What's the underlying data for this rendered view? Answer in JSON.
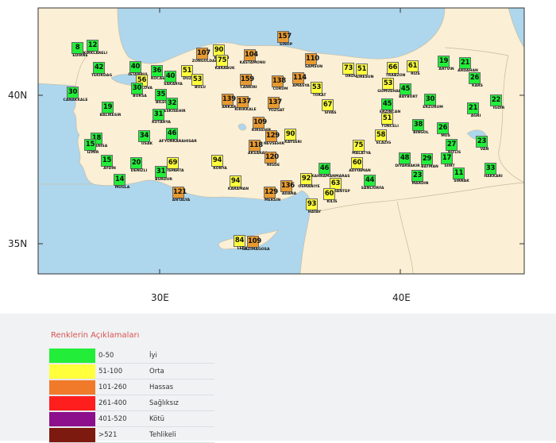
{
  "map": {
    "lat_labels": [
      "40N",
      "35N"
    ],
    "lon_labels": [
      "30E",
      "40E"
    ]
  },
  "stations": [
    {
      "city": "EDIRNE",
      "value": 8,
      "level": "iyi"
    },
    {
      "city": "KIRKLARELI",
      "value": 12,
      "level": "iyi"
    },
    {
      "city": "TEKIRDAG",
      "value": 42,
      "level": "iyi"
    },
    {
      "city": "ISTANBUL",
      "value": 40,
      "level": "iyi"
    },
    {
      "city": "KOCAELI",
      "value": 36,
      "level": "iyi"
    },
    {
      "city": "SAKARYA",
      "value": 40,
      "level": "iyi"
    },
    {
      "city": "YALOVA",
      "value": 56,
      "level": "orta"
    },
    {
      "city": "DUZCE",
      "value": 51,
      "level": "orta"
    },
    {
      "city": "BOLU",
      "value": 53,
      "level": "orta"
    },
    {
      "city": "ZONGULDAK",
      "value": 107,
      "level": "hassas"
    },
    {
      "city": "BARTIN",
      "value": 90,
      "level": "orta"
    },
    {
      "city": "KARABUK",
      "value": 75,
      "level": "orta"
    },
    {
      "city": "KASTAMONU",
      "value": 104,
      "level": "hassas"
    },
    {
      "city": "SINOP",
      "value": 157,
      "level": "hassas"
    },
    {
      "city": "SAMSUN",
      "value": 110,
      "level": "hassas"
    },
    {
      "city": "ORDU",
      "value": 73,
      "level": "orta"
    },
    {
      "city": "GIRESUN",
      "value": 51,
      "level": "orta"
    },
    {
      "city": "TRABZON",
      "value": 66,
      "level": "orta"
    },
    {
      "city": "RIZE",
      "value": 61,
      "level": "orta"
    },
    {
      "city": "ARTVIN",
      "value": 19,
      "level": "iyi"
    },
    {
      "city": "ARDAHAN",
      "value": 21,
      "level": "iyi"
    },
    {
      "city": "KARS",
      "value": 26,
      "level": "iyi"
    },
    {
      "city": "CANAKKALE",
      "value": 30,
      "level": "iyi"
    },
    {
      "city": "BURSA",
      "value": 30,
      "level": "iyi"
    },
    {
      "city": "BILECIK",
      "value": 35,
      "level": "iyi"
    },
    {
      "city": "ESKISEHIR",
      "value": 32,
      "level": "iyi"
    },
    {
      "city": "KUTAHYA",
      "value": 31,
      "level": "iyi"
    },
    {
      "city": "BALIKESIR",
      "value": 19,
      "level": "iyi"
    },
    {
      "city": "ANKARA",
      "value": 139,
      "level": "hassas"
    },
    {
      "city": "CANKIRI",
      "value": 159,
      "level": "hassas"
    },
    {
      "city": "KIRIKKALE",
      "value": 137,
      "level": "hassas"
    },
    {
      "city": "CORUM",
      "value": 138,
      "level": "hassas"
    },
    {
      "city": "AMASYA",
      "value": 114,
      "level": "hassas"
    },
    {
      "city": "TOKAT",
      "value": 53,
      "level": "orta"
    },
    {
      "city": "YOZGAT",
      "value": 137,
      "level": "hassas"
    },
    {
      "city": "SIVAS",
      "value": 67,
      "level": "orta"
    },
    {
      "city": "GUMUSHANE",
      "value": 53,
      "level": "orta"
    },
    {
      "city": "BAYBURT",
      "value": 45,
      "level": "iyi"
    },
    {
      "city": "ERZINCAN",
      "value": 45,
      "level": "iyi"
    },
    {
      "city": "ERZURUM",
      "value": 30,
      "level": "iyi"
    },
    {
      "city": "AGRI",
      "value": 21,
      "level": "iyi"
    },
    {
      "city": "IGDIR",
      "value": 22,
      "level": "iyi"
    },
    {
      "city": "TUNCELI",
      "value": 51,
      "level": "orta"
    },
    {
      "city": "BINGOL",
      "value": 38,
      "level": "iyi"
    },
    {
      "city": "MUS",
      "value": 26,
      "level": "iyi"
    },
    {
      "city": "BITLIS",
      "value": 27,
      "level": "iyi"
    },
    {
      "city": "VAN",
      "value": 23,
      "level": "iyi"
    },
    {
      "city": "HAKKARI",
      "value": 33,
      "level": "iyi"
    },
    {
      "city": "MANISA",
      "value": 18,
      "level": "iyi"
    },
    {
      "city": "IZMIR",
      "value": 15,
      "level": "iyi"
    },
    {
      "city": "AYDIN",
      "value": 15,
      "level": "iyi"
    },
    {
      "city": "MUGLA",
      "value": 14,
      "level": "iyi"
    },
    {
      "city": "USAK",
      "value": 34,
      "level": "iyi"
    },
    {
      "city": "AFYONKARAHISAR",
      "value": 46,
      "level": "iyi"
    },
    {
      "city": "DENIZLI",
      "value": 20,
      "level": "iyi"
    },
    {
      "city": "ISPARTA",
      "value": 69,
      "level": "orta"
    },
    {
      "city": "BURDUR",
      "value": 31,
      "level": "iyi"
    },
    {
      "city": "ANTALYA",
      "value": 121,
      "level": "hassas"
    },
    {
      "city": "KONYA",
      "value": 94,
      "level": "orta"
    },
    {
      "city": "KARAMAN",
      "value": 94,
      "level": "orta"
    },
    {
      "city": "KIRSEHIR",
      "value": 109,
      "level": "hassas"
    },
    {
      "city": "NEVSEHIR",
      "value": 129,
      "level": "hassas"
    },
    {
      "city": "AKSARAY",
      "value": 118,
      "level": "hassas"
    },
    {
      "city": "KAYSERI",
      "value": 90,
      "level": "orta"
    },
    {
      "city": "NIGDE",
      "value": 120,
      "level": "hassas"
    },
    {
      "city": "MERSIN",
      "value": 129,
      "level": "hassas"
    },
    {
      "city": "ADANA",
      "value": 136,
      "level": "hassas"
    },
    {
      "city": "OSMANIYE",
      "value": 92,
      "level": "orta"
    },
    {
      "city": "KAHRAMANMARAS",
      "value": 46,
      "level": "iyi"
    },
    {
      "city": "GAZIANTEP",
      "value": 63,
      "level": "orta"
    },
    {
      "city": "KILIS",
      "value": 60,
      "level": "orta"
    },
    {
      "city": "HATAY",
      "value": 93,
      "level": "orta"
    },
    {
      "city": "MALATYA",
      "value": 75,
      "level": "orta"
    },
    {
      "city": "ELAZIG",
      "value": 58,
      "level": "orta"
    },
    {
      "city": "ADIYAMAN",
      "value": 60,
      "level": "orta"
    },
    {
      "city": "SANLIURFA",
      "value": 44,
      "level": "iyi"
    },
    {
      "city": "DIYARBAKIR",
      "value": 48,
      "level": "iyi"
    },
    {
      "city": "BATMAN",
      "value": 29,
      "level": "iyi"
    },
    {
      "city": "SIIRT",
      "value": 17,
      "level": "iyi"
    },
    {
      "city": "MARDIN",
      "value": 23,
      "level": "iyi"
    },
    {
      "city": "SIRNAK",
      "value": 11,
      "level": "iyi"
    },
    {
      "city": "LEFK",
      "value": 84,
      "level": "orta"
    },
    {
      "city": "GAZIMAGOSA",
      "value": 109,
      "level": "hassas"
    }
  ],
  "legend": {
    "title": "Renklerin Açıklamaları",
    "items": [
      {
        "range": "0-50",
        "label": "İyi",
        "color": "#22ee3a"
      },
      {
        "range": "51-100",
        "label": "Orta",
        "color": "#ffff3c"
      },
      {
        "range": "101-260",
        "label": "Hassas",
        "color": "#f07a2a"
      },
      {
        "range": "261-400",
        "label": "Sağlıksız",
        "color": "#ff1e1e"
      },
      {
        "range": "401-520",
        "label": "Kötü",
        "color": "#8c0f8c"
      },
      {
        "range": ">521",
        "label": "Tehlikeli",
        "color": "#7d1a10"
      }
    ]
  },
  "colors": {
    "iyi": "#22ee3a",
    "orta": "#ffff3c",
    "hassas": "#e89a30",
    "sea": "#aed6ec",
    "land": "#fbefd5",
    "border": "#c9b99c"
  }
}
